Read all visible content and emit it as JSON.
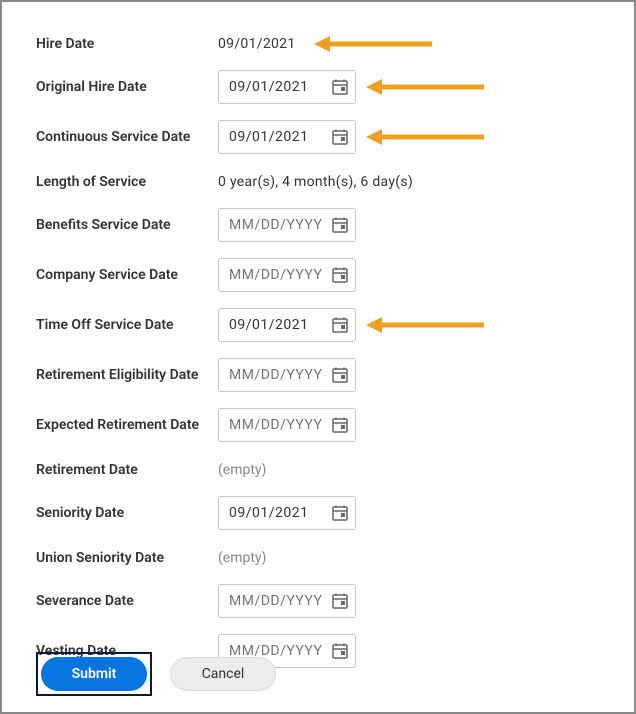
{
  "fields": {
    "hireDate": {
      "label": "Hire Date",
      "value": "09/01/2021"
    },
    "originalHireDate": {
      "label": "Original Hire Date",
      "value": "09/01/2021",
      "placeholder": "MM/DD/YYYY"
    },
    "continuousServiceDate": {
      "label": "Continuous Service Date",
      "value": "09/01/2021",
      "placeholder": "MM/DD/YYYY"
    },
    "lengthOfService": {
      "label": "Length of Service",
      "value": "0 year(s), 4 month(s), 6 day(s)"
    },
    "benefitsServiceDate": {
      "label": "Benefits Service Date",
      "value": "",
      "placeholder": "MM/DD/YYYY"
    },
    "companyServiceDate": {
      "label": "Company Service Date",
      "value": "",
      "placeholder": "MM/DD/YYYY"
    },
    "timeOffServiceDate": {
      "label": "Time Off Service Date",
      "value": "09/01/2021",
      "placeholder": "MM/DD/YYYY"
    },
    "retirementEligibilityDate": {
      "label": "Retirement Eligibility Date",
      "value": "",
      "placeholder": "MM/DD/YYYY"
    },
    "expectedRetirementDate": {
      "label": "Expected Retirement Date",
      "value": "",
      "placeholder": "MM/DD/YYYY"
    },
    "retirementDate": {
      "label": "Retirement Date",
      "value": "(empty)"
    },
    "seniorityDate": {
      "label": "Seniority Date",
      "value": "09/01/2021",
      "placeholder": "MM/DD/YYYY"
    },
    "unionSeniorityDate": {
      "label": "Union Seniority Date",
      "value": "(empty)"
    },
    "severanceDate": {
      "label": "Severance Date",
      "value": "",
      "placeholder": "MM/DD/YYYY"
    },
    "vestingDate": {
      "label": "Vesting Date",
      "value": "",
      "placeholder": "MM/DD/YYYY"
    }
  },
  "buttons": {
    "submit": "Submit",
    "cancel": "Cancel"
  },
  "colors": {
    "accent": "#0875e1",
    "arrow": "#f0a020"
  }
}
